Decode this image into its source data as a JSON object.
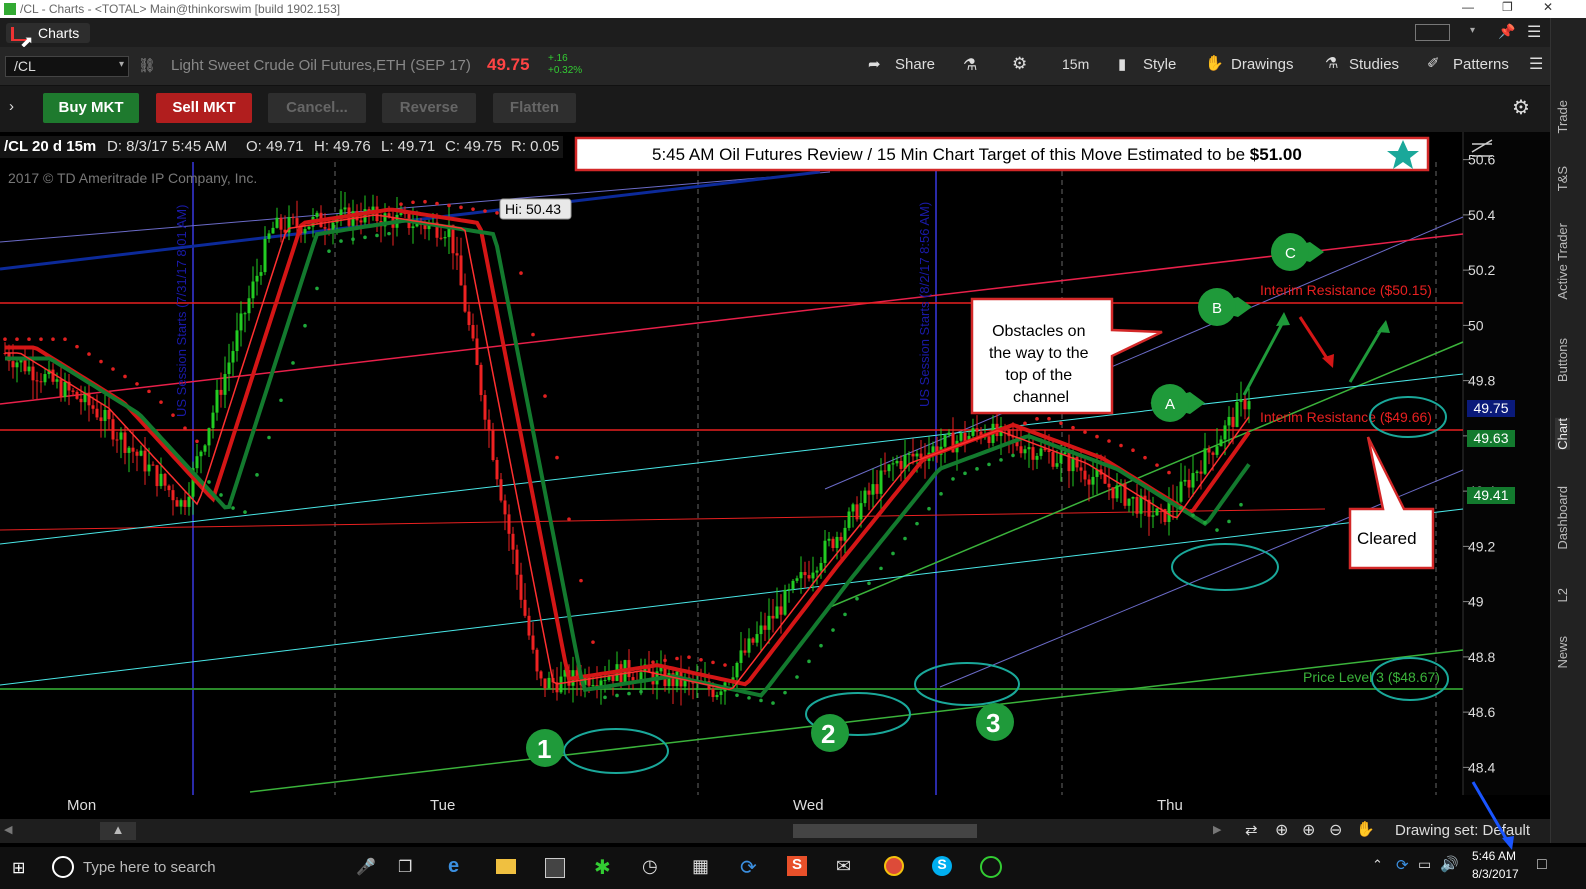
{
  "window": {
    "title": "/CL - Charts - <TOTAL> Main@thinkorswim [build 1902.153]",
    "tab_label": "Charts"
  },
  "toolbar": {
    "symbol": "/CL",
    "instrument": "Light Sweet Crude Oil Futures,ETH (SEP 17)",
    "last_price": "49.75",
    "change_abs": "+.16",
    "change_pct": "+0.32%",
    "share": "Share",
    "timeframe": "15m",
    "style": "Style",
    "drawings": "Drawings",
    "studies": "Studies",
    "patterns": "Patterns"
  },
  "tradebar": {
    "buy": "Buy MKT",
    "sell": "Sell MKT",
    "cancel": "Cancel...",
    "reverse": "Reverse",
    "flatten": "Flatten"
  },
  "right_tabs": [
    "Trade",
    "T&S",
    "Active Trader",
    "Buttons",
    "Chart",
    "Dashboard",
    "L2",
    "News"
  ],
  "chart_info": {
    "label": "/CL 20 d 15m",
    "date": "D: 8/3/17 5:45 AM",
    "open": "O: 49.71",
    "high": "H: 49.76",
    "low": "L: 49.71",
    "close": "C: 49.75",
    "range": "R: 0.05",
    "copyright": "2017 © TD Ameritrade IP Company, Inc."
  },
  "annotations": {
    "banner_main": "5:45 AM Oil Futures Review / 15 Min Chart   Target of this Move Estimated to be ",
    "banner_target": "$51.00",
    "hi_label": "Hi: 50.43",
    "session1": "US Session Starts (7/31/17 8:01 AM)",
    "session2": "US Session Starts (8/2/17 8:56 AM)",
    "obstacles": "Obstacles on the way to the top of the channel",
    "cleared": "Cleared",
    "res1": "Interim Resistance ($50.15)",
    "res2": "Interim Resistance ($49.66)",
    "price_level": "Price Level 3 ($48.67)",
    "marker_a": "A",
    "marker_b": "B",
    "marker_c": "C",
    "n1": "1",
    "n2": "2",
    "n3": "3"
  },
  "price_tags": {
    "last": "49.75",
    "ma": "49.63",
    "ma2": "49.41"
  },
  "chart_data": {
    "type": "line",
    "y_ticks": [
      "50.6",
      "50.4",
      "50.2",
      "50",
      "49.8",
      "49.6",
      "49.4",
      "49.2",
      "49",
      "48.8",
      "48.6",
      "48.4"
    ],
    "x_ticks": [
      "Mon",
      "Tue",
      "Wed",
      "Thu"
    ],
    "ylim": [
      48.3,
      50.7
    ],
    "series": [
      {
        "name": "",
        "x": [
          "Mon",
          "",
          "",
          "",
          "Tue",
          "",
          "",
          "",
          "Wed",
          "",
          "",
          "",
          "Thu",
          "",
          ""
        ],
        "values": [
          49.9,
          49.7,
          49.35,
          50.35,
          50.4,
          50.35,
          48.7,
          48.75,
          48.68,
          49.1,
          49.5,
          49.62,
          49.5,
          49.3,
          49.75
        ]
      }
    ]
  },
  "bottom": {
    "drawing_set": "Drawing set: Default",
    "search": "Type here to search",
    "time": "5:46 AM",
    "date": "8/3/2017"
  }
}
